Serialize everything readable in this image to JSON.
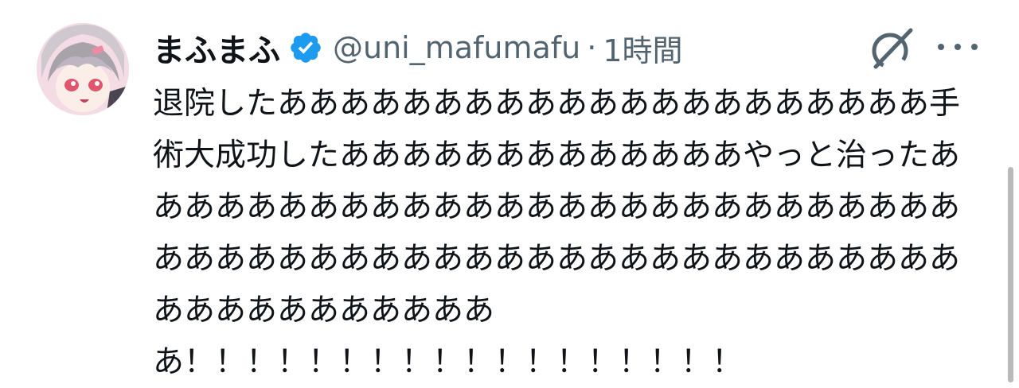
{
  "tweet": {
    "display_name": "まふまふ",
    "handle": "@uni_mafumafu",
    "separator": "·",
    "time": "1時間",
    "text": "退院したあああああああああああああああああああああ手術大成功したあああああああああああああやっと治ったああああああああああああああああああああああああああああああああああああああああああああああああああああああああああああああああ\nあ！！！！！！！！！！！！！！！！！！"
  },
  "icons": {
    "verified": "verified-badge-icon",
    "grok": "grok-icon",
    "more": "more-options-icon"
  },
  "colors": {
    "verified": "#1d9bf0",
    "secondary_text": "#536471",
    "primary_text": "#0f1419"
  }
}
